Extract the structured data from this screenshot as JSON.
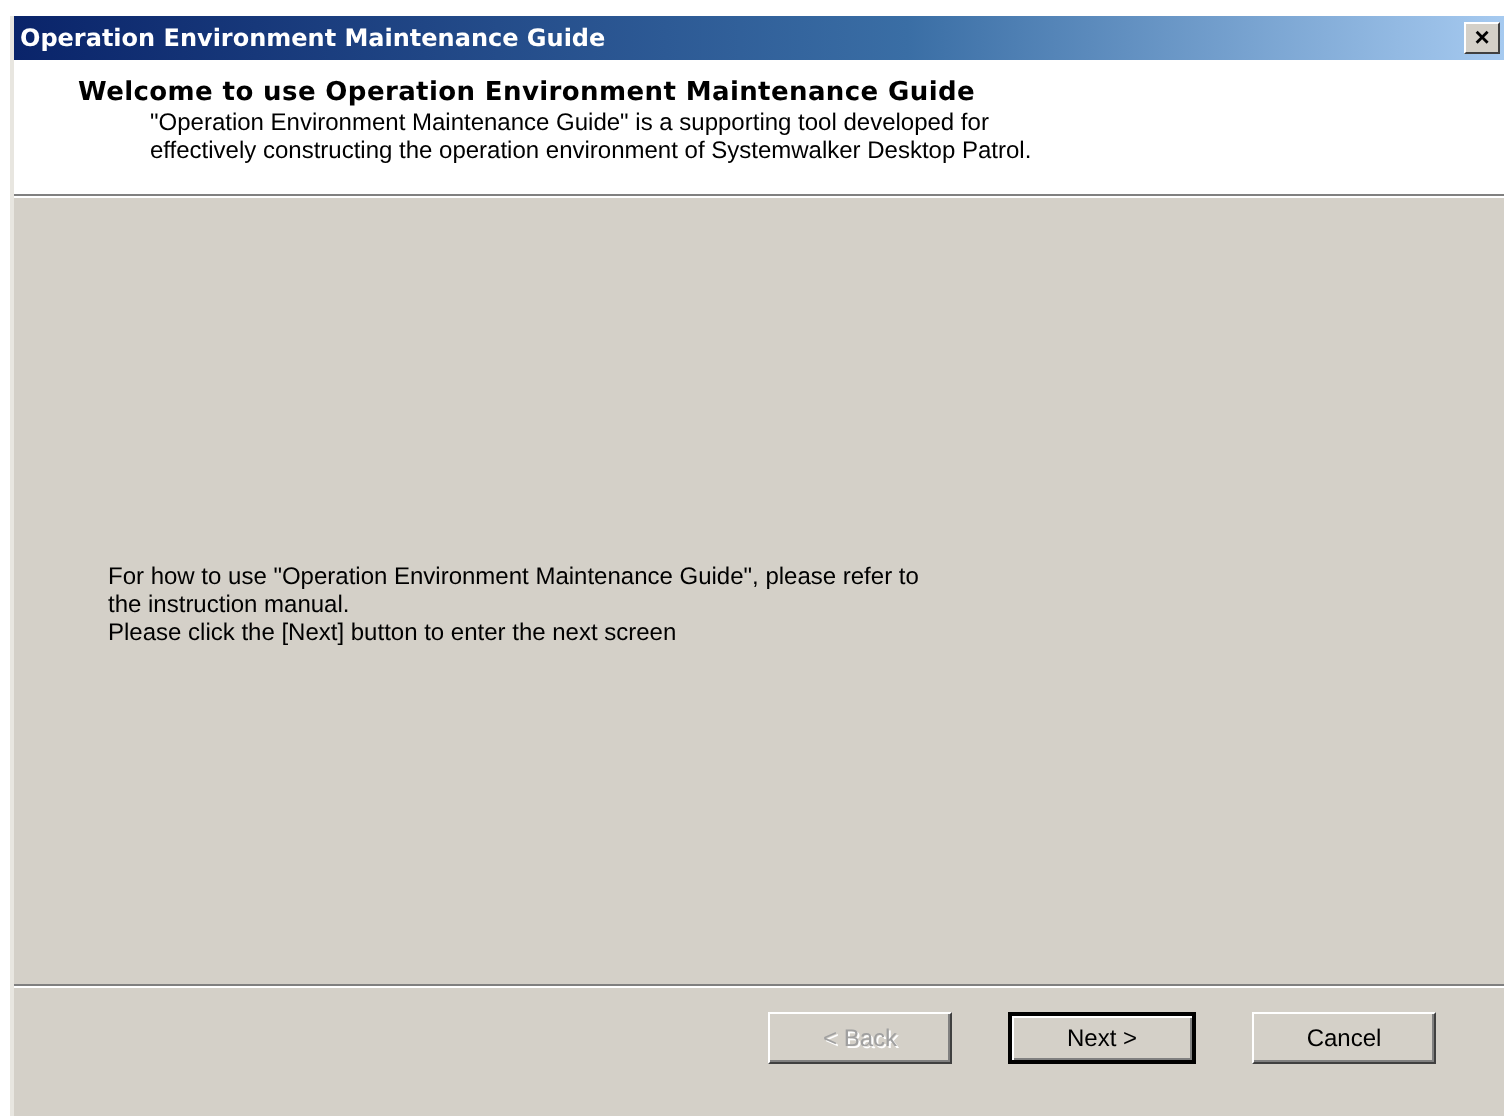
{
  "window": {
    "title": "Operation Environment Maintenance Guide",
    "close": "×"
  },
  "header": {
    "title": "Welcome to use Operation Environment Maintenance Guide",
    "description": [
      "\"Operation Environment Maintenance Guide\" is a supporting tool developed for",
      "effectively constructing the operation environment of Systemwalker Desktop Patrol."
    ]
  },
  "body": [
    "For how to use \"Operation Environment Maintenance Guide\", please refer to",
    "the instruction manual.",
    "Please click the [Next] button to enter the next screen"
  ],
  "buttons": [
    {
      "label": "< Back",
      "disabled": true,
      "default": false
    },
    {
      "label": "Next >",
      "disabled": false,
      "default": true
    },
    {
      "label": "Cancel",
      "disabled": false,
      "default": false
    }
  ]
}
